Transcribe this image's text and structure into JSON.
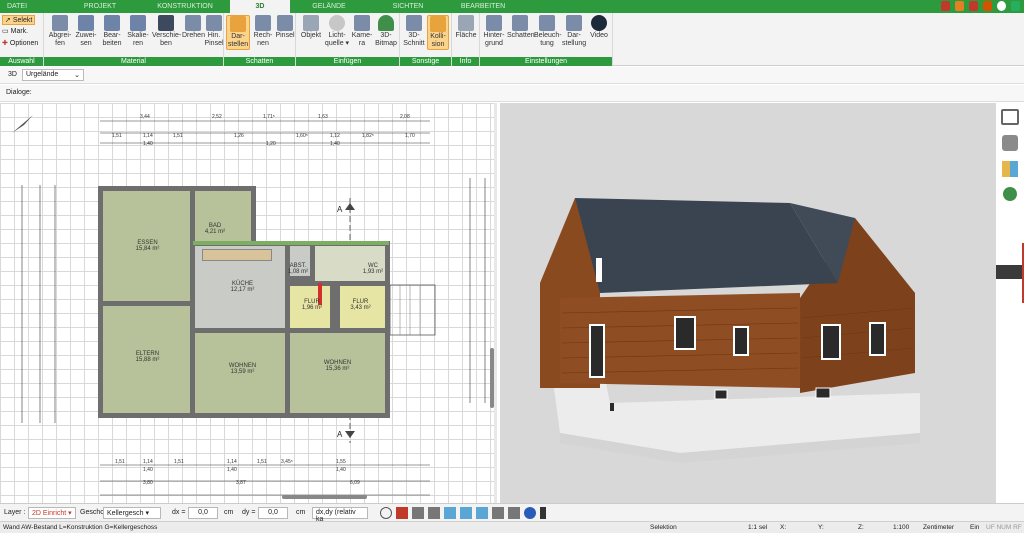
{
  "tabs": [
    "DATEI",
    "PROJEKT",
    "KONSTRUKTION",
    "3D",
    "GELÄNDE",
    "SICHTEN",
    "BEARBEITEN"
  ],
  "auswahl": {
    "selekt": "Selekt",
    "mark": "Mark.",
    "optionen": "Optionen",
    "label": "Auswahl"
  },
  "material": {
    "label": "Material",
    "buttons": [
      "Abgrei-\nfen",
      "Zuwei-\nsen",
      "Bear-\nbeiten",
      "Skalie-\nren",
      "Verschie-\nben",
      "Drehen",
      "Hin.\nPinsel"
    ]
  },
  "schatten": {
    "label": "Schatten",
    "buttons": [
      "Dar-\nstellen",
      "Rech-\nnen",
      "Pinsel"
    ]
  },
  "einfuegen": {
    "label": "Einfügen",
    "buttons": [
      "Objekt",
      "Licht-\nquelle ▾",
      "Kame-\nra",
      "3D-\nBitmap"
    ]
  },
  "sonstige": {
    "label": "Sonstige",
    "buttons": [
      "3D-\nSchnitt",
      "Kolli-\nsion"
    ]
  },
  "info": {
    "label": "Info",
    "buttons": [
      "Fläche"
    ]
  },
  "einstellungen": {
    "label": "Einstellungen",
    "buttons": [
      "Hinter-\ngrund",
      "Schatten",
      "Beleuch-\ntung",
      "Dar-\nstellung",
      "Video"
    ]
  },
  "viewselector": {
    "tag": "3D",
    "value": "Urgelände"
  },
  "dialoge": "Dialoge:",
  "rooms": [
    {
      "name": "ESSEN",
      "area": "15,84 m²"
    },
    {
      "name": "BAD",
      "area": "4,21 m²"
    },
    {
      "name": "KÜCHE",
      "area": "12,17 m²"
    },
    {
      "name": "ABST.",
      "area": "1,08 m²"
    },
    {
      "name": "WC",
      "area": "1,93 m²"
    },
    {
      "name": "FLUR",
      "area": "1,96 m²"
    },
    {
      "name": "FLUR",
      "area": "3,43 m²"
    },
    {
      "name": "ELTERN",
      "area": "15,88 m²"
    },
    {
      "name": "WOHNEN",
      "area": "13,59 m²"
    },
    {
      "name": "WOHNEN",
      "area": "15,36 m²"
    }
  ],
  "dims_top": [
    "3,44",
    "2,52",
    "1,71⁵",
    "1,63",
    "2,08",
    "1,51",
    "1,14",
    "1,51",
    "1,26",
    "1,60⁵",
    "1,12",
    "1,82⁵",
    "1,70",
    "1,40",
    "1,20",
    "1,40"
  ],
  "dims_bottom": [
    "1,51",
    "1,14",
    "1,51",
    "1,14",
    "1,51",
    "3,45⁵",
    "1,55",
    "1,40",
    "1,40",
    "1,40",
    "3,80",
    "3,87",
    "6,09"
  ],
  "section_marker": "A",
  "bottom": {
    "layer_label": "Layer :",
    "layer_value": "2D Einricht ▾",
    "geschoss_label": "Geschoss :",
    "geschoss_value": "Kellergesch ▾",
    "dx_label": "dx =",
    "dx_value": "0,0",
    "dy_label": "dy =",
    "dy_value": "0,0",
    "unit": "cm",
    "mode": "dx,dy (relativ ka"
  },
  "status": {
    "left": "Wand AW-Bestand L=Konstruktion G=Kellergeschoss",
    "selektion": "Selektion",
    "sel": "1:1 sel",
    "x": "X:",
    "y": "Y:",
    "z": "Z:",
    "scale": "1:100",
    "unit": "Zentimeter",
    "ein": "Ein",
    "flags": "UF NUM RF"
  },
  "colors": {
    "brand": "#2e9a3e",
    "roof": "#3a4450",
    "wood": "#8a4a20",
    "plaster": "#ececec"
  }
}
